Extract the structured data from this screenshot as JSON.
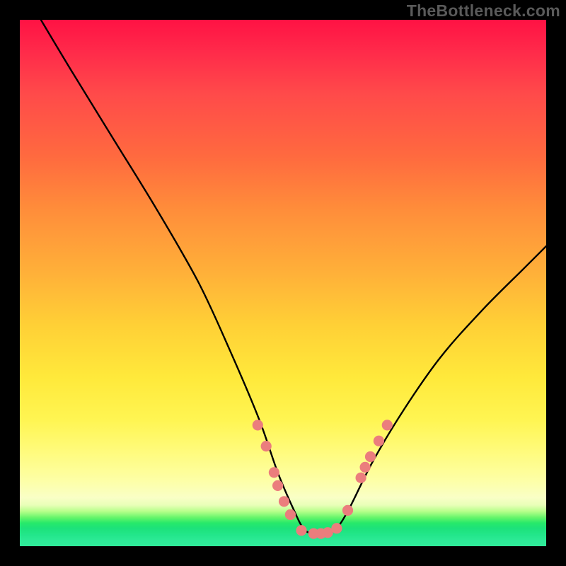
{
  "watermark": "TheBottleneck.com",
  "chart_data": {
    "type": "line",
    "title": "",
    "xlabel": "",
    "ylabel": "",
    "xlim": [
      0,
      100
    ],
    "ylim": [
      0,
      100
    ],
    "grid": false,
    "legend": false,
    "series": [
      {
        "name": "bottleneck-curve",
        "x": [
          4,
          10,
          18,
          26,
          34,
          40,
          45.5,
          49,
          52,
          54,
          56,
          58,
          60,
          62.5,
          67,
          73,
          80,
          88,
          96,
          100
        ],
        "values": [
          100,
          90,
          77,
          64,
          50,
          37,
          24,
          14,
          7,
          3.2,
          2.4,
          2.4,
          3.2,
          7,
          16,
          26,
          36,
          45,
          53,
          57
        ]
      }
    ],
    "markers": {
      "name": "highlight-dots",
      "color": "#eb7d7d",
      "points": [
        {
          "x": 45.2,
          "y": 23
        },
        {
          "x": 46.8,
          "y": 19
        },
        {
          "x": 48.3,
          "y": 14
        },
        {
          "x": 49.0,
          "y": 11.5
        },
        {
          "x": 50.2,
          "y": 8.5
        },
        {
          "x": 51.4,
          "y": 6
        },
        {
          "x": 53.5,
          "y": 3
        },
        {
          "x": 55.8,
          "y": 2.4
        },
        {
          "x": 57.2,
          "y": 2.4
        },
        {
          "x": 58.5,
          "y": 2.6
        },
        {
          "x": 60.2,
          "y": 3.4
        },
        {
          "x": 62.3,
          "y": 6.8
        },
        {
          "x": 64.8,
          "y": 13
        },
        {
          "x": 65.6,
          "y": 15
        },
        {
          "x": 66.6,
          "y": 17
        },
        {
          "x": 68.2,
          "y": 20
        },
        {
          "x": 69.8,
          "y": 23
        }
      ]
    }
  }
}
